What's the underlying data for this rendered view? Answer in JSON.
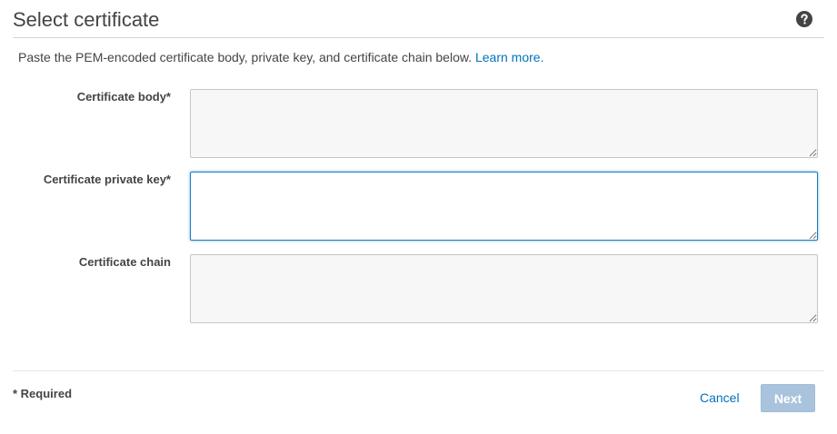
{
  "header": {
    "title": "Select certificate",
    "help_icon": "question-circle-icon"
  },
  "intro": {
    "text": "Paste the PEM-encoded certificate body, private key, and certificate chain below.",
    "link_text": "Learn more."
  },
  "fields": [
    {
      "label": "Certificate body*",
      "value": "",
      "focused": false
    },
    {
      "label": "Certificate private key*",
      "value": "",
      "focused": true
    },
    {
      "label": "Certificate chain",
      "value": "",
      "focused": false
    }
  ],
  "footer": {
    "required_note": "* Required",
    "cancel_label": "Cancel",
    "next_label": "Next",
    "next_disabled": true
  },
  "colors": {
    "link": "#0073bb",
    "focus_border": "#1a7bbd",
    "disabled_button": "#a9c3dd"
  }
}
